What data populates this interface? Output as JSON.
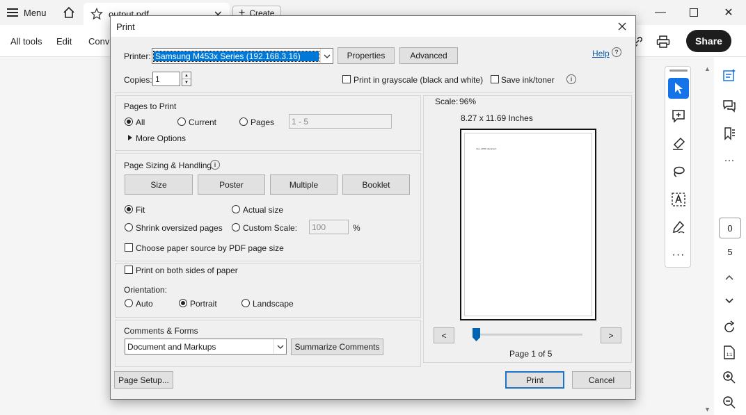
{
  "app": {
    "menu_label": "Menu",
    "tab_title": "output.pdf",
    "create_label": "Create",
    "toolbar": {
      "all_tools": "All tools",
      "edit": "Edit",
      "convert": "Conve"
    },
    "share_label": "Share",
    "page_current": "0",
    "page_total": "5"
  },
  "dialog": {
    "title": "Print",
    "printer_label": "Printer:",
    "printer_value": "Samsung M453x Series (192.168.3.16)",
    "properties_label": "Properties",
    "advanced_label": "Advanced",
    "help_label": "Help",
    "copies_label": "Copies:",
    "copies_value": "1",
    "grayscale_label": "Print in grayscale (black and white)",
    "save_ink_label": "Save ink/toner",
    "pages_to_print": {
      "heading": "Pages to Print",
      "all": "All",
      "current": "Current",
      "pages": "Pages",
      "pages_range": "1 - 5",
      "more_options": "More Options"
    },
    "sizing": {
      "heading": "Page Sizing & Handling",
      "tabs": [
        "Size",
        "Poster",
        "Multiple",
        "Booklet"
      ],
      "fit": "Fit",
      "actual_size": "Actual size",
      "shrink": "Shrink oversized pages",
      "custom_scale": "Custom Scale:",
      "custom_scale_value": "100",
      "percent": "%",
      "paper_source": "Choose paper source by PDF page size"
    },
    "both_sides_label": "Print on both sides of paper",
    "orientation": {
      "heading": "Orientation:",
      "auto": "Auto",
      "portrait": "Portrait",
      "landscape": "Landscape"
    },
    "comments": {
      "heading": "Comments & Forms",
      "value": "Document and Markups",
      "summarize_label": "Summarize Comments"
    },
    "preview": {
      "scale_label": "Scale:",
      "scale_value": "96%",
      "paper_size": "8.27 x 11.69 Inches",
      "page_text": "I am a PDF document",
      "prev": "<",
      "next": ">",
      "page_indicator": "Page 1 of 5"
    },
    "page_setup_label": "Page Setup...",
    "print_label": "Print",
    "cancel_label": "Cancel"
  },
  "colors": {
    "accent": "#1473e6",
    "selection": "#0078d7",
    "share_bg": "#1d1d1d"
  }
}
